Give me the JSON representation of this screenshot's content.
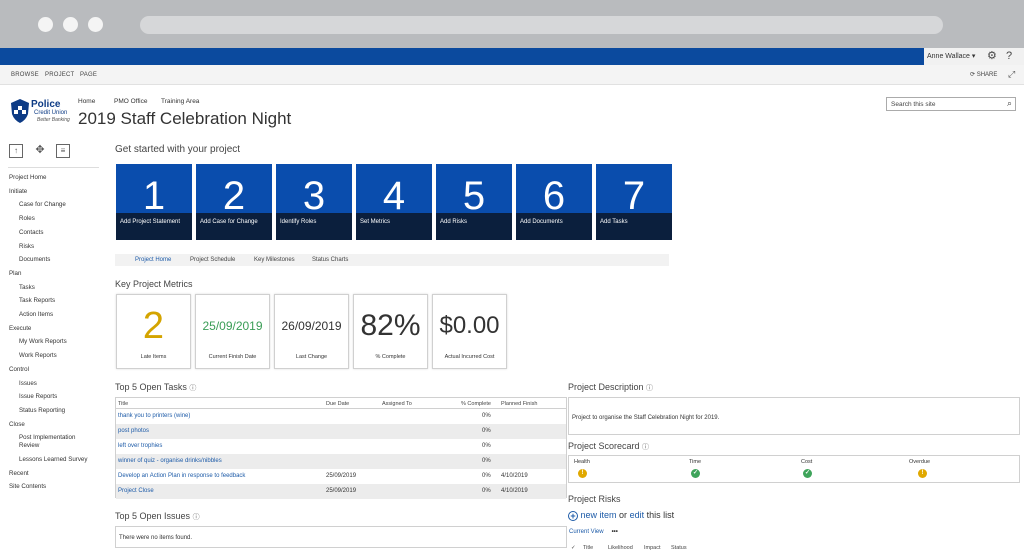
{
  "user": {
    "name": "Anne Wallace",
    "caret": "▾"
  },
  "icons": {
    "settings": "gear-icon",
    "help": "help-icon",
    "share": "share-icon",
    "focus": "focus-icon",
    "search": "search-icon",
    "info": "info-icon"
  },
  "ribbon": {
    "tabs": [
      "BROWSE",
      "PROJECT",
      "PAGE"
    ],
    "share_label": "SHARE"
  },
  "logo": {
    "line1": "Police",
    "line2": "Credit Union",
    "line3": "Better Banking"
  },
  "topnav": [
    "Home",
    "PMO Office",
    "Training Area"
  ],
  "site": {
    "title": "2019 Staff Celebration Night"
  },
  "search": {
    "placeholder": "Search this site"
  },
  "leftnav": [
    {
      "label": "Project Home",
      "level": 0
    },
    {
      "label": "Initiate",
      "level": 0
    },
    {
      "label": "Case for Change",
      "level": 1
    },
    {
      "label": "Roles",
      "level": 1
    },
    {
      "label": "Contacts",
      "level": 1
    },
    {
      "label": "Risks",
      "level": 1
    },
    {
      "label": "Documents",
      "level": 1
    },
    {
      "label": "Plan",
      "level": 0
    },
    {
      "label": "Tasks",
      "level": 1
    },
    {
      "label": "Task Reports",
      "level": 1
    },
    {
      "label": "Action Items",
      "level": 1
    },
    {
      "label": "Execute",
      "level": 0
    },
    {
      "label": "My Work Reports",
      "level": 1
    },
    {
      "label": "Work Reports",
      "level": 1
    },
    {
      "label": "Control",
      "level": 0
    },
    {
      "label": "Issues",
      "level": 1
    },
    {
      "label": "Issue Reports",
      "level": 1
    },
    {
      "label": "Status Reporting",
      "level": 1
    },
    {
      "label": "Close",
      "level": 0
    },
    {
      "label": "Post Implementation Review",
      "level": 1
    },
    {
      "label": "Lessons Learned Survey",
      "level": 1
    },
    {
      "label": "Recent",
      "level": 0
    },
    {
      "label": "Site Contents",
      "level": 0
    }
  ],
  "getstarted": {
    "heading": "Get started with your project",
    "tiles": [
      {
        "num": "1",
        "label": "Add Project Statement"
      },
      {
        "num": "2",
        "label": "Add Case for Change"
      },
      {
        "num": "3",
        "label": "Identify Roles"
      },
      {
        "num": "4",
        "label": "Set Metrics"
      },
      {
        "num": "5",
        "label": "Add Risks"
      },
      {
        "num": "6",
        "label": "Add Documents"
      },
      {
        "num": "7",
        "label": "Add Tasks"
      }
    ]
  },
  "subnav": [
    "Project Home",
    "Project Schedule",
    "Key Milestones",
    "Status Charts"
  ],
  "metrics": {
    "heading": "Key Project Metrics",
    "items": [
      {
        "value": "2",
        "caption": "Late Items",
        "color": "#d4a400"
      },
      {
        "value": "25/09/2019",
        "caption": "Current Finish Date",
        "color": "#3a9d56"
      },
      {
        "value": "26/09/2019",
        "caption": "Last Change",
        "color": "#333333"
      },
      {
        "value": "82%",
        "caption": "% Complete",
        "color": "#333333"
      },
      {
        "value": "$0.00",
        "caption": "Actual Incurred Cost",
        "color": "#333333"
      }
    ]
  },
  "tasks": {
    "heading": "Top 5 Open Tasks",
    "columns": [
      "Title",
      "Due Date",
      "Assigned To",
      "% Complete",
      "Planned Finish"
    ],
    "rows": [
      {
        "title": "thank you to printers (wine)",
        "due": "",
        "assigned": "",
        "pct": "0%",
        "finish": ""
      },
      {
        "title": "post photos",
        "due": "",
        "assigned": "",
        "pct": "0%",
        "finish": ""
      },
      {
        "title": "left over trophies",
        "due": "",
        "assigned": "",
        "pct": "0%",
        "finish": ""
      },
      {
        "title": "winner of quiz - organise drinks/nibbles",
        "due": "",
        "assigned": "",
        "pct": "0%",
        "finish": ""
      },
      {
        "title": "Develop an Action Plan in response to feedback",
        "due": "25/09/2019",
        "assigned": "",
        "pct": "0%",
        "finish": "4/10/2019"
      },
      {
        "title": "Project Close",
        "due": "25/09/2019",
        "assigned": "",
        "pct": "0%",
        "finish": "4/10/2019"
      }
    ]
  },
  "issues": {
    "heading": "Top 5 Open Issues",
    "empty": "There were no items found."
  },
  "description": {
    "heading": "Project Description",
    "text": "Project to organise the Staff Celebration Night for 2019."
  },
  "scorecard": {
    "heading": "Project Scorecard",
    "items": [
      {
        "label": "Health",
        "status": "warning",
        "color": "#e0a800",
        "glyph": "!"
      },
      {
        "label": "Time",
        "status": "ok",
        "color": "#3fa45b",
        "glyph": "✓"
      },
      {
        "label": "Cost",
        "status": "ok",
        "color": "#3fa45b",
        "glyph": "✓"
      },
      {
        "label": "Overdue",
        "status": "warning",
        "color": "#e0a800",
        "glyph": "!"
      }
    ]
  },
  "risks": {
    "heading": "Project Risks",
    "new_item": "new item",
    "or": "or",
    "edit": "edit",
    "this_list": "this list",
    "current_view": "Current View",
    "ellipsis": "•••",
    "columns": [
      "Title",
      "Likelihood",
      "Impact",
      "Status"
    ]
  }
}
